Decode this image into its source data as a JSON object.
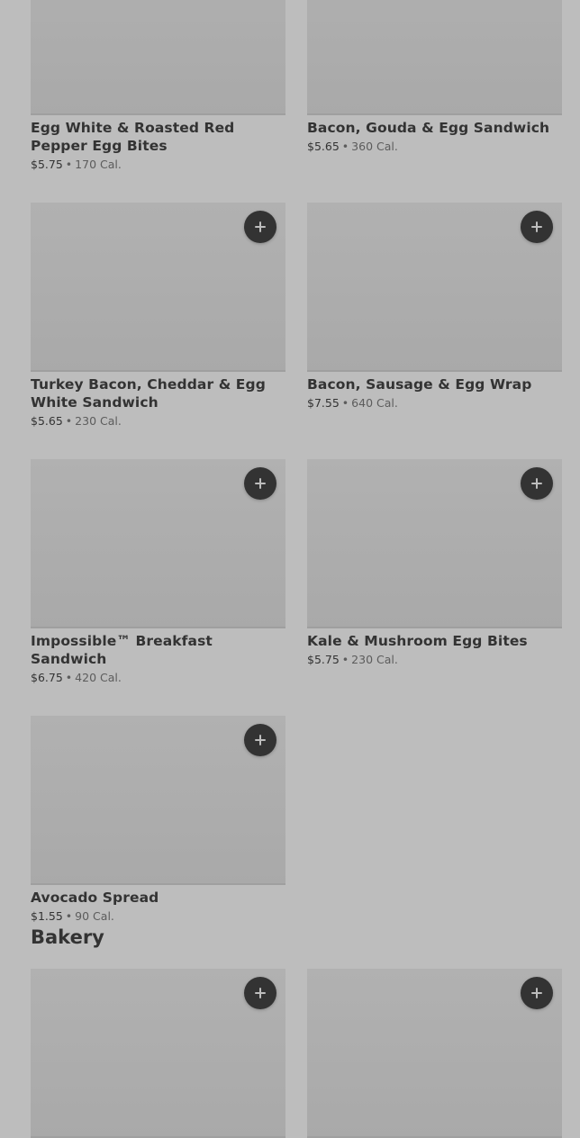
{
  "sections": [
    {
      "items": [
        {
          "name": "Egg White & Roasted Red Pepper Egg Bites",
          "price": "$5.75",
          "calories": "170 Cal.",
          "add_button": false
        },
        {
          "name": "Bacon, Gouda & Egg Sandwich",
          "price": "$5.65",
          "calories": "360 Cal.",
          "add_button": false
        },
        {
          "name": "Turkey Bacon, Cheddar & Egg White Sandwich",
          "price": "$5.65",
          "calories": "230 Cal.",
          "add_button": true
        },
        {
          "name": "Bacon, Sausage & Egg Wrap",
          "price": "$7.55",
          "calories": "640 Cal.",
          "add_button": true
        },
        {
          "name": "Impossible™ Breakfast Sandwich",
          "price": "$6.75",
          "calories": "420 Cal.",
          "add_button": true
        },
        {
          "name": "Kale & Mushroom Egg Bites",
          "price": "$5.75",
          "calories": "230 Cal.",
          "add_button": true
        },
        {
          "name": "Avocado Spread",
          "price": "$1.55",
          "calories": "90 Cal.",
          "add_button": true
        }
      ]
    },
    {
      "title": "Bakery",
      "items": [
        {
          "name": "",
          "price": "",
          "calories": "",
          "add_button": true
        },
        {
          "name": "",
          "price": "",
          "calories": "",
          "add_button": true
        }
      ]
    }
  ],
  "separator": "•",
  "icons": {
    "add": "plus-icon"
  },
  "colors": {
    "background": "#bdbdbd",
    "image_placeholder": "#adadad",
    "text": "#333333",
    "button": "#333333"
  }
}
